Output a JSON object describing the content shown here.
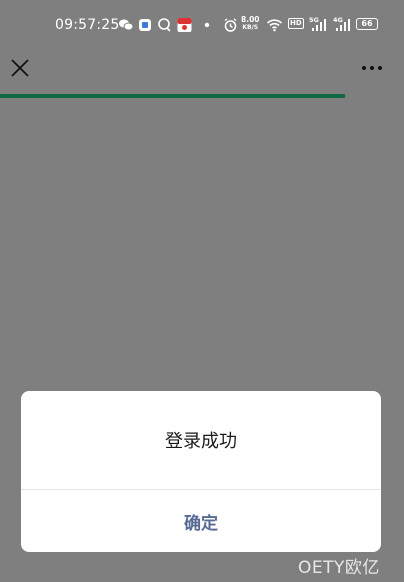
{
  "statusbar": {
    "time": "09:57:25",
    "speed_value": "8.00",
    "speed_unit": "KB/S",
    "hd_label": "HD",
    "sig1_label": "5G",
    "sig2_label": "4G",
    "battery": "66"
  },
  "titlebar": {
    "close_icon": "close-icon",
    "more_icon": "more-icon"
  },
  "progress": {
    "fraction": 0.855,
    "color": "#0f6b43"
  },
  "dialog": {
    "message": "登录成功",
    "confirm_label": "确定",
    "confirm_color": "#576b95"
  },
  "watermark": "OETY欧亿"
}
